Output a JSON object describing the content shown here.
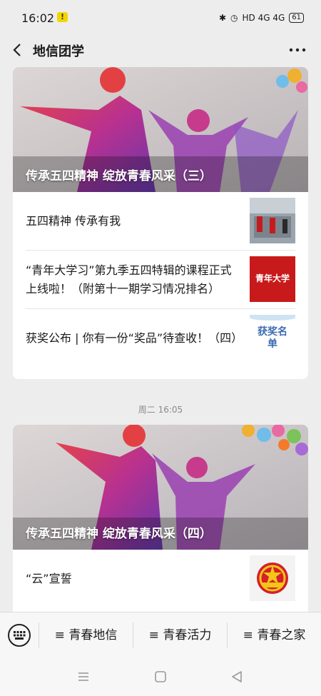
{
  "status": {
    "time": "16:02",
    "network": "HD 4G 4G",
    "battery": "61"
  },
  "nav": {
    "title": "地信团学"
  },
  "article_group_1": {
    "cover_title": "传承五四精神 绽放青春风采（三）",
    "items": [
      {
        "title": "五四精神 传承有我"
      },
      {
        "title": "“青年大学习”第九季五四特辑的课程正式上线啦！（附第十一期学习情况排名）"
      },
      {
        "title": "获奖公布 | 你有一份“奖品”待查收！（四）"
      }
    ],
    "thumb_labels": {
      "youth_study": "青年大学",
      "award": "获奖名单"
    }
  },
  "timestamp": "周二 16:05",
  "article_group_2": {
    "cover_title": "传承五四精神 绽放青春风采（四）",
    "items": [
      {
        "title": "“云”宣誓"
      }
    ]
  },
  "menu": {
    "tabs": [
      {
        "label": "≡ 青春地信"
      },
      {
        "label": "≡ 青春活力"
      },
      {
        "label": "≡ 青春之家"
      }
    ]
  }
}
